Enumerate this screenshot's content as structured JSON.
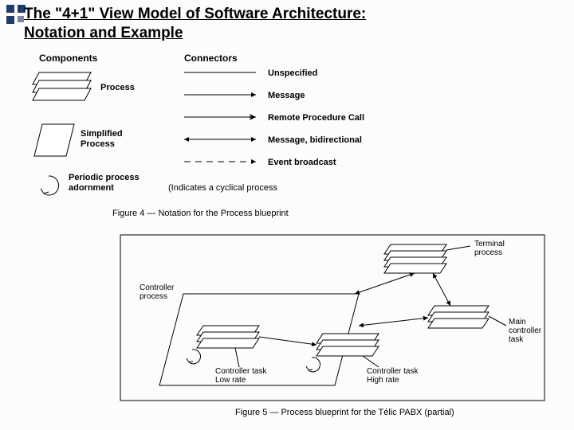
{
  "title_line1": "The \"4+1\" View Model of Software Architecture:",
  "title_line2": "Notation and Example",
  "fig4": {
    "heading_components": "Components",
    "heading_connectors": "Connectors",
    "label_process": "Process",
    "label_simplified": "Simplified",
    "label_simplified2": "Process",
    "label_periodic1": "Periodic process",
    "label_periodic2": "adornment",
    "conn_unspecified": "Unspecified",
    "conn_message": "Message",
    "conn_rpc": "Remote Procedure Call",
    "conn_bidi": "Message, bidirectional",
    "conn_event": "Event broadcast",
    "note_cyclical": "(Indicates a cyclical process",
    "caption": "Figure 4 — Notation for the Process blueprint"
  },
  "fig5": {
    "label_controller_process": "Controller",
    "label_controller_process2": "process",
    "label_terminal1": "Terminal",
    "label_terminal2": "process",
    "label_main1": "Main",
    "label_main2": "controller",
    "label_main3": "task",
    "label_ct_low1": "Controller task",
    "label_ct_low2": "Low rate",
    "label_ct_high1": "Controller task",
    "label_ct_high2": "High rate",
    "caption": "Figure 5 — Process blueprint for the Télic PABX (partial)"
  }
}
